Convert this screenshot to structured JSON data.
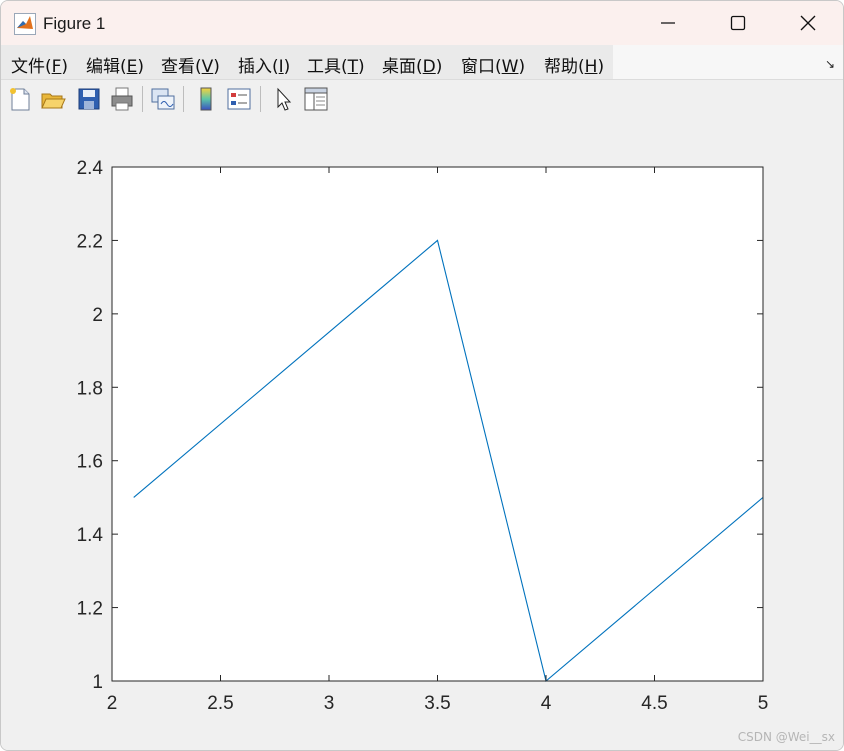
{
  "window": {
    "title": "Figure 1"
  },
  "menu": [
    {
      "label": "文件(",
      "mnemonic": "F",
      "suffix": ")"
    },
    {
      "label": "编辑(",
      "mnemonic": "E",
      "suffix": ")"
    },
    {
      "label": "查看(",
      "mnemonic": "V",
      "suffix": ")"
    },
    {
      "label": "插入(",
      "mnemonic": "I",
      "suffix": ")"
    },
    {
      "label": "工具(",
      "mnemonic": "T",
      "suffix": ")"
    },
    {
      "label": "桌面(",
      "mnemonic": "D",
      "suffix": ")"
    },
    {
      "label": "窗口(",
      "mnemonic": "W",
      "suffix": ")"
    },
    {
      "label": "帮助(",
      "mnemonic": "H",
      "suffix": ")"
    }
  ],
  "menu_dock_glyph": "↘",
  "toolbar": [
    "new-figure-icon",
    "open-file-icon",
    "save-icon",
    "print-icon",
    "link-plot-icon",
    "insert-colorbar-icon",
    "insert-legend-icon",
    "edit-plot-icon",
    "property-inspector-icon"
  ],
  "watermark": "CSDN @Wei__sx",
  "chart_data": {
    "type": "line",
    "x": [
      2.1,
      3.5,
      4.0,
      5.0
    ],
    "series": [
      {
        "values": [
          1.5,
          2.2,
          1.0,
          1.5
        ],
        "color": "#0072bd"
      }
    ],
    "xlim": [
      2,
      5
    ],
    "ylim": [
      1,
      2.4
    ],
    "xticks": [
      2,
      2.5,
      3,
      3.5,
      4,
      4.5,
      5
    ],
    "yticks": [
      1,
      1.2,
      1.4,
      1.6,
      1.8,
      2,
      2.2,
      2.4
    ],
    "xtick_labels": [
      "2",
      "2.5",
      "3",
      "3.5",
      "4",
      "4.5",
      "5"
    ],
    "ytick_labels": [
      "1",
      "1.2",
      "1.4",
      "1.6",
      "1.8",
      "2",
      "2.2",
      "2.4"
    ],
    "grid": false,
    "title": "",
    "xlabel": "",
    "ylabel": ""
  }
}
